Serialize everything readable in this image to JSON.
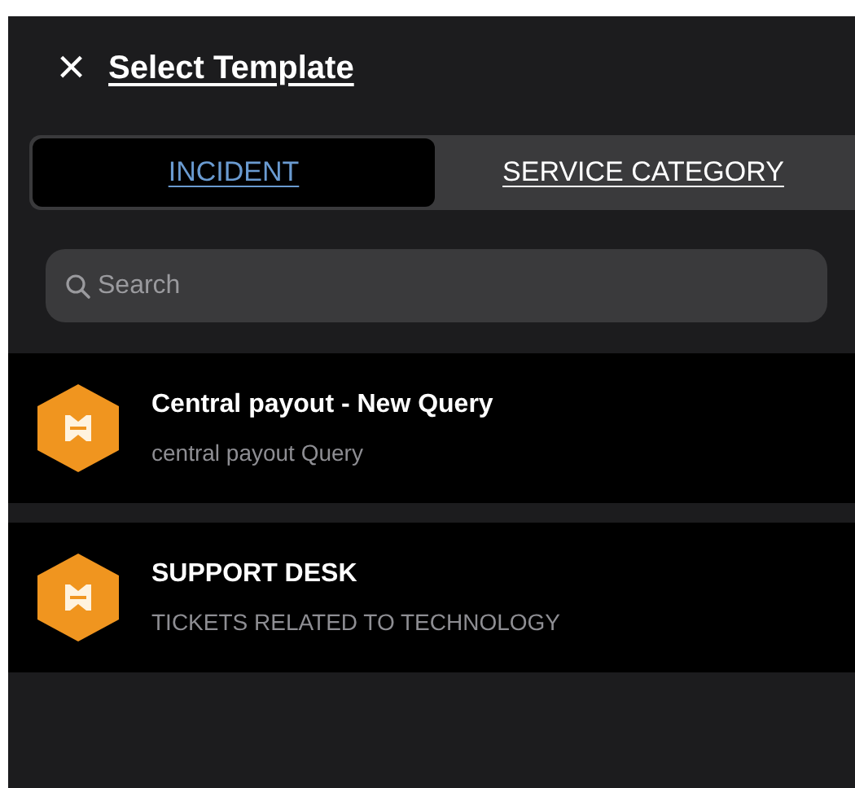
{
  "header": {
    "close": "×",
    "title": "Select Template"
  },
  "tabs": [
    {
      "label": "INCIDENT",
      "selected": true
    },
    {
      "label": "SERVICE CATEGORY",
      "selected": false
    }
  ],
  "search": {
    "placeholder": "Search"
  },
  "templates": [
    {
      "title": "Central payout - New Query",
      "subtitle": "central payout Query"
    },
    {
      "title": "SUPPORT DESK",
      "subtitle": "TICKETS RELATED TO TECHNOLOGY"
    }
  ]
}
